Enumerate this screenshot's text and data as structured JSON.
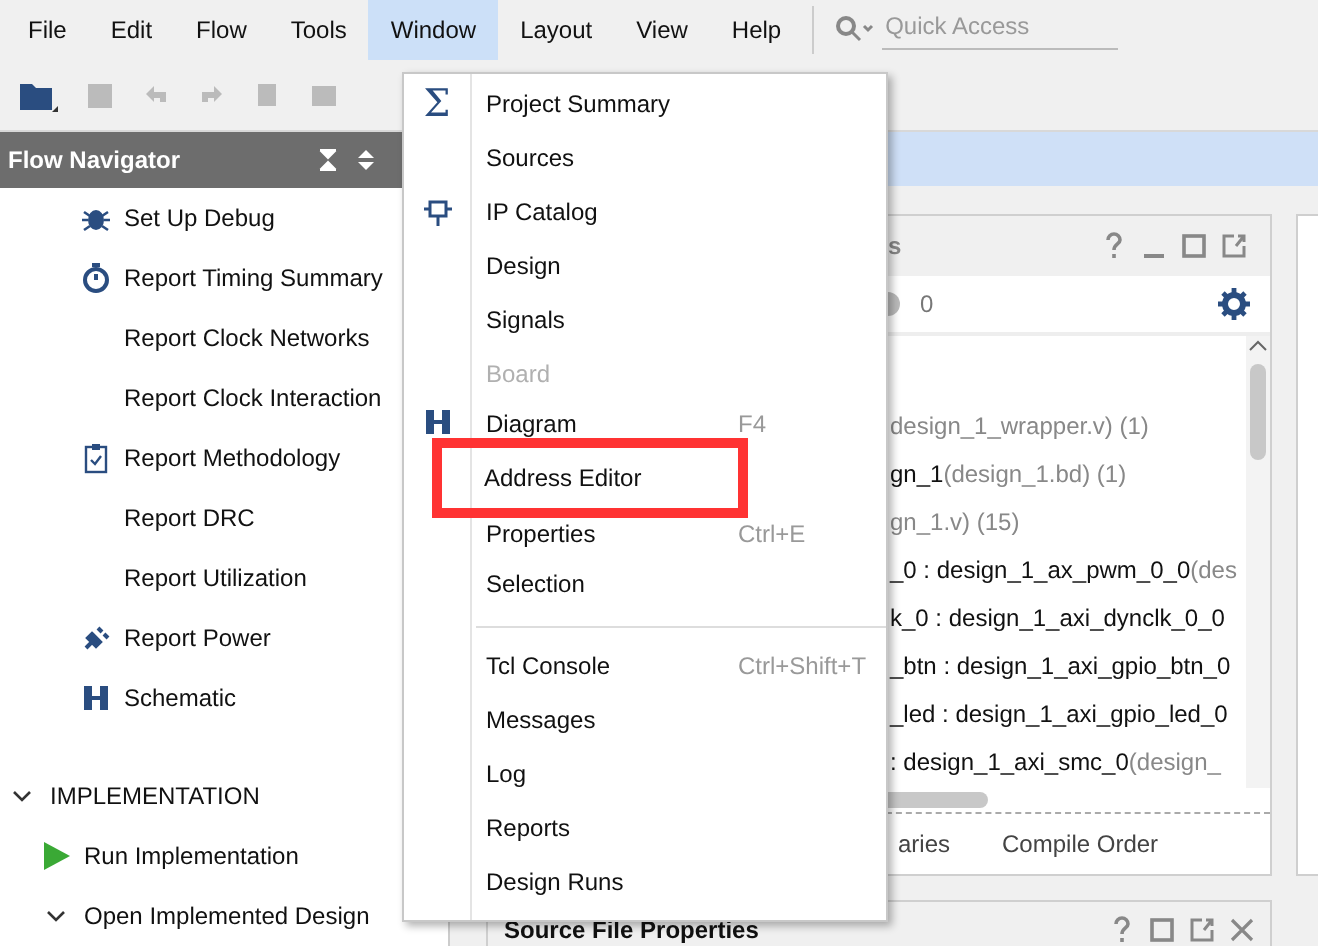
{
  "menubar": [
    {
      "label": "File",
      "selected": false
    },
    {
      "label": "Edit",
      "selected": false
    },
    {
      "label": "Flow",
      "selected": false
    },
    {
      "label": "Tools",
      "selected": false
    },
    {
      "label": "Window",
      "selected": true
    },
    {
      "label": "Layout",
      "selected": false
    },
    {
      "label": "View",
      "selected": false
    },
    {
      "label": "Help",
      "selected": false
    }
  ],
  "quick_access": {
    "placeholder": "Quick Access"
  },
  "flow_navigator": {
    "title": "Flow Navigator",
    "items": [
      {
        "kind": "debug",
        "label": "Set Up Debug"
      },
      {
        "kind": "timer",
        "label": "Report Timing Summary"
      },
      {
        "kind": "plain",
        "label": "Report Clock Networks"
      },
      {
        "kind": "plain",
        "label": "Report Clock Interaction"
      },
      {
        "kind": "clipboard",
        "label": "Report Methodology"
      },
      {
        "kind": "plain",
        "label": "Report DRC"
      },
      {
        "kind": "plain",
        "label": "Report Utilization"
      },
      {
        "kind": "power",
        "label": "Report Power"
      },
      {
        "kind": "schematic",
        "label": "Schematic"
      }
    ],
    "section": {
      "label": "IMPLEMENTATION",
      "expanded": true,
      "items": [
        {
          "kind": "run",
          "label": "Run Implementation"
        },
        {
          "kind": "group",
          "label": "Open Implemented Design",
          "expanded": true
        }
      ]
    }
  },
  "window_menu": [
    {
      "kind": "glyph",
      "glyph": "Σ",
      "label": "Project Summary",
      "disabled": false
    },
    {
      "kind": "plain",
      "label": "Sources",
      "disabled": false
    },
    {
      "kind": "chip",
      "label": "IP Catalog",
      "disabled": false
    },
    {
      "kind": "plain",
      "label": "Design",
      "disabled": false
    },
    {
      "kind": "plain",
      "label": "Signals",
      "disabled": false
    },
    {
      "kind": "plain",
      "label": "Board",
      "disabled": true
    },
    {
      "kind": "diagram",
      "label": "Diagram",
      "shortcut": "F4",
      "disabled": false,
      "highlighted": false
    },
    {
      "kind": "plain",
      "label": "Address Editor",
      "disabled": false,
      "highlighted": true
    },
    {
      "kind": "plain",
      "label": "Properties",
      "shortcut": "Ctrl+E",
      "disabled": false
    },
    {
      "kind": "plain",
      "label": "Selection",
      "disabled": false
    },
    {
      "kind": "separator"
    },
    {
      "kind": "plain",
      "label": "Tcl Console",
      "shortcut": "Ctrl+Shift+T",
      "disabled": false
    },
    {
      "kind": "plain",
      "label": "Messages",
      "disabled": false
    },
    {
      "kind": "plain",
      "label": "Log",
      "disabled": false
    },
    {
      "kind": "plain",
      "label": "Reports",
      "disabled": false
    },
    {
      "kind": "plain",
      "label": "Design Runs",
      "disabled": false
    }
  ],
  "sources_panel": {
    "tab": "s",
    "count": "0",
    "rows": [
      {
        "name": "",
        "detail": "design_1_wrapper.v) (1)"
      },
      {
        "name": "gn_1",
        "detail": " (design_1.bd) (1)"
      },
      {
        "name": "",
        "detail": "gn_1.v) (15)"
      },
      {
        "name": "_0 : design_1_ax_pwm_0_0",
        "detail": " (des"
      },
      {
        "name": "k_0 : design_1_axi_dynclk_0_0",
        "detail": ""
      },
      {
        "name": "_btn : design_1_axi_gpio_btn_0",
        "detail": ""
      },
      {
        "name": "_led : design_1_axi_gpio_led_0",
        "detail": ""
      },
      {
        "name": ": design_1_axi_smc_0",
        "detail": " (design_"
      }
    ],
    "bottom_tabs": [
      {
        "label": "aries",
        "selected": false
      },
      {
        "label": "Compile Order",
        "selected": false
      }
    ]
  },
  "properties_panel": {
    "title": "Source File Properties"
  }
}
